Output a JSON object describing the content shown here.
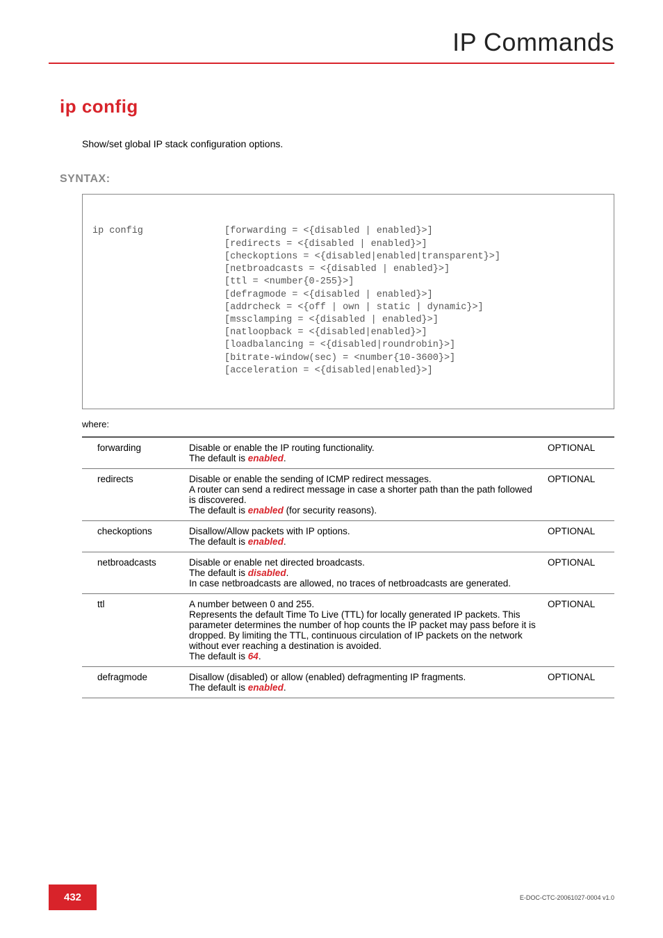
{
  "header": {
    "title": "IP Commands"
  },
  "command": {
    "title": "ip config"
  },
  "intro": "Show/set global IP stack configuration options.",
  "syntax": {
    "label": "SYNTAX:",
    "cmd": "ip config",
    "lines": [
      "[forwarding = <{disabled | enabled}>]",
      "[redirects = <{disabled | enabled}>]",
      "[checkoptions = <{disabled|enabled|transparent}>]",
      "[netbroadcasts = <{disabled | enabled}>]",
      "[ttl = <number{0-255}>]",
      "[defragmode = <{disabled | enabled}>]",
      "[addrcheck = <{off | own | static | dynamic}>]",
      "[mssclamping = <{disabled | enabled}>]",
      "[natloopback = <{disabled|enabled}>]",
      "[loadbalancing = <{disabled|roundrobin}>]",
      "[bitrate-window(sec) = <number{10-3600}>]",
      "[acceleration = <{disabled|enabled}>]"
    ]
  },
  "where_label": "where:",
  "params": [
    {
      "name": "forwarding",
      "desc_parts": [
        {
          "t": "Disable or enable the IP routing functionality."
        },
        {
          "br": true
        },
        {
          "t": "The default is "
        },
        {
          "t": "enabled",
          "em": true
        },
        {
          "t": "."
        }
      ],
      "req": "OPTIONAL"
    },
    {
      "name": "redirects",
      "desc_parts": [
        {
          "t": "Disable or enable the sending of ICMP redirect messages."
        },
        {
          "br": true
        },
        {
          "t": "A router can send a redirect message in case a shorter path than the path followed is discovered."
        },
        {
          "br": true
        },
        {
          "t": "The default is "
        },
        {
          "t": "enabled",
          "em": true
        },
        {
          "t": " (for security reasons)."
        }
      ],
      "req": "OPTIONAL"
    },
    {
      "name": "checkoptions",
      "desc_parts": [
        {
          "t": "Disallow/Allow packets with IP options."
        },
        {
          "br": true
        },
        {
          "t": "The default is "
        },
        {
          "t": "enabled",
          "em": true
        },
        {
          "t": "."
        }
      ],
      "req": "OPTIONAL"
    },
    {
      "name": "netbroadcasts",
      "desc_parts": [
        {
          "t": "Disable or enable net directed broadcasts."
        },
        {
          "br": true
        },
        {
          "t": "The default is "
        },
        {
          "t": "disabled",
          "em": true
        },
        {
          "t": "."
        },
        {
          "br": true
        },
        {
          "t": "In case netbroadcasts are allowed, no traces of netbroadcasts are generated."
        }
      ],
      "req": "OPTIONAL"
    },
    {
      "name": "ttl",
      "desc_parts": [
        {
          "t": "A number between 0 and 255."
        },
        {
          "br": true
        },
        {
          "t": "Represents the default Time To Live (TTL) for locally generated IP packets. This parameter determines the number of hop counts the IP packet may pass before it is dropped. By limiting the TTL, continuous circulation of IP packets on the network without ever reaching a destination is avoided."
        },
        {
          "br": true
        },
        {
          "t": "The default is "
        },
        {
          "t": "64",
          "em": true
        },
        {
          "t": "."
        }
      ],
      "req": "OPTIONAL"
    },
    {
      "name": "defragmode",
      "desc_parts": [
        {
          "t": "Disallow (disabled) or allow (enabled) defragmenting IP fragments."
        },
        {
          "br": true
        },
        {
          "t": "The default is "
        },
        {
          "t": "enabled",
          "em": true
        },
        {
          "t": "."
        }
      ],
      "req": "OPTIONAL"
    }
  ],
  "footer": {
    "page": "432",
    "docid": "E-DOC-CTC-20061027-0004 v1.0"
  }
}
